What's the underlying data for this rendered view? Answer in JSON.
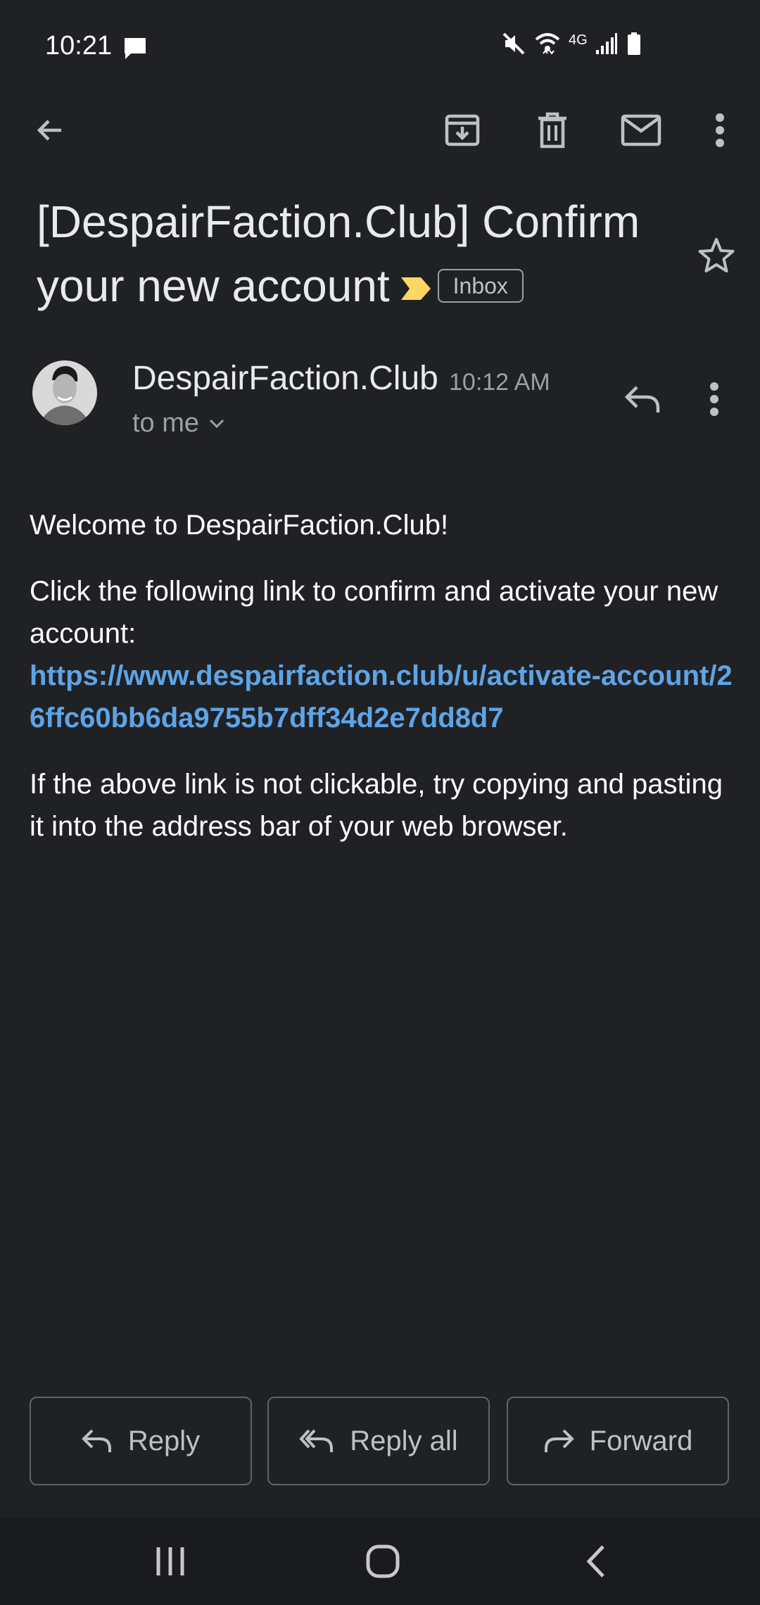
{
  "status_bar": {
    "time": "10:21",
    "network": "4G",
    "icons": [
      "message-icon",
      "mute-icon",
      "wifi-icon",
      "signal-icon",
      "battery-icon"
    ]
  },
  "toolbar": {
    "icons": [
      "back-arrow-icon",
      "archive-icon",
      "delete-icon",
      "mark-unread-icon",
      "more-vert-icon"
    ]
  },
  "email": {
    "subject": "[DespairFaction.Club] Confirm your new account",
    "label": "Inbox",
    "sender_name": "DespairFaction.Club",
    "time": "10:12 AM",
    "recipient": "to me",
    "body": {
      "greeting": "Welcome to DespairFaction.Club!",
      "instruction": "Click the following link to confirm and activate your new account:",
      "link": "https://www.despairfaction.club/u/activate-account/26ffc60bb6da9755b7dff34d2e7dd8d7",
      "fallback": "If the above link is not clickable, try copying and pasting it into the address bar of your web browser."
    }
  },
  "actions": {
    "reply": "Reply",
    "reply_all": "Reply all",
    "forward": "Forward"
  },
  "colors": {
    "background": "#202124",
    "link": "#5ea4e6",
    "importance_marker": "#fdd663"
  }
}
